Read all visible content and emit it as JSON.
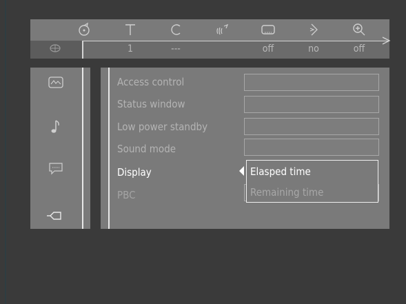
{
  "top_bar": {
    "icons": [
      {
        "name": "disc-icon",
        "glyph": "⚙"
      },
      {
        "name": "title-icon",
        "glyph": "T"
      },
      {
        "name": "chapter-icon",
        "glyph": "C"
      },
      {
        "name": "audio-icon",
        "glyph": "((ˆ"
      },
      {
        "name": "subtitle-icon",
        "glyph": "…"
      },
      {
        "name": "angle-icon",
        "glyph": "⋗"
      },
      {
        "name": "zoom-icon",
        "glyph": "⊕"
      }
    ],
    "values": {
      "title": "1",
      "chapter": "---",
      "subtitle": "off",
      "angle": "no",
      "zoom": "off"
    }
  },
  "menu": {
    "items": [
      {
        "label": "Access control"
      },
      {
        "label": "Status window"
      },
      {
        "label": "Low power standby"
      },
      {
        "label": "Sound mode"
      },
      {
        "label": "Display"
      },
      {
        "label": "PBC"
      }
    ]
  },
  "display_options": {
    "selected": "Elasped time",
    "other": "Remaining time"
  }
}
